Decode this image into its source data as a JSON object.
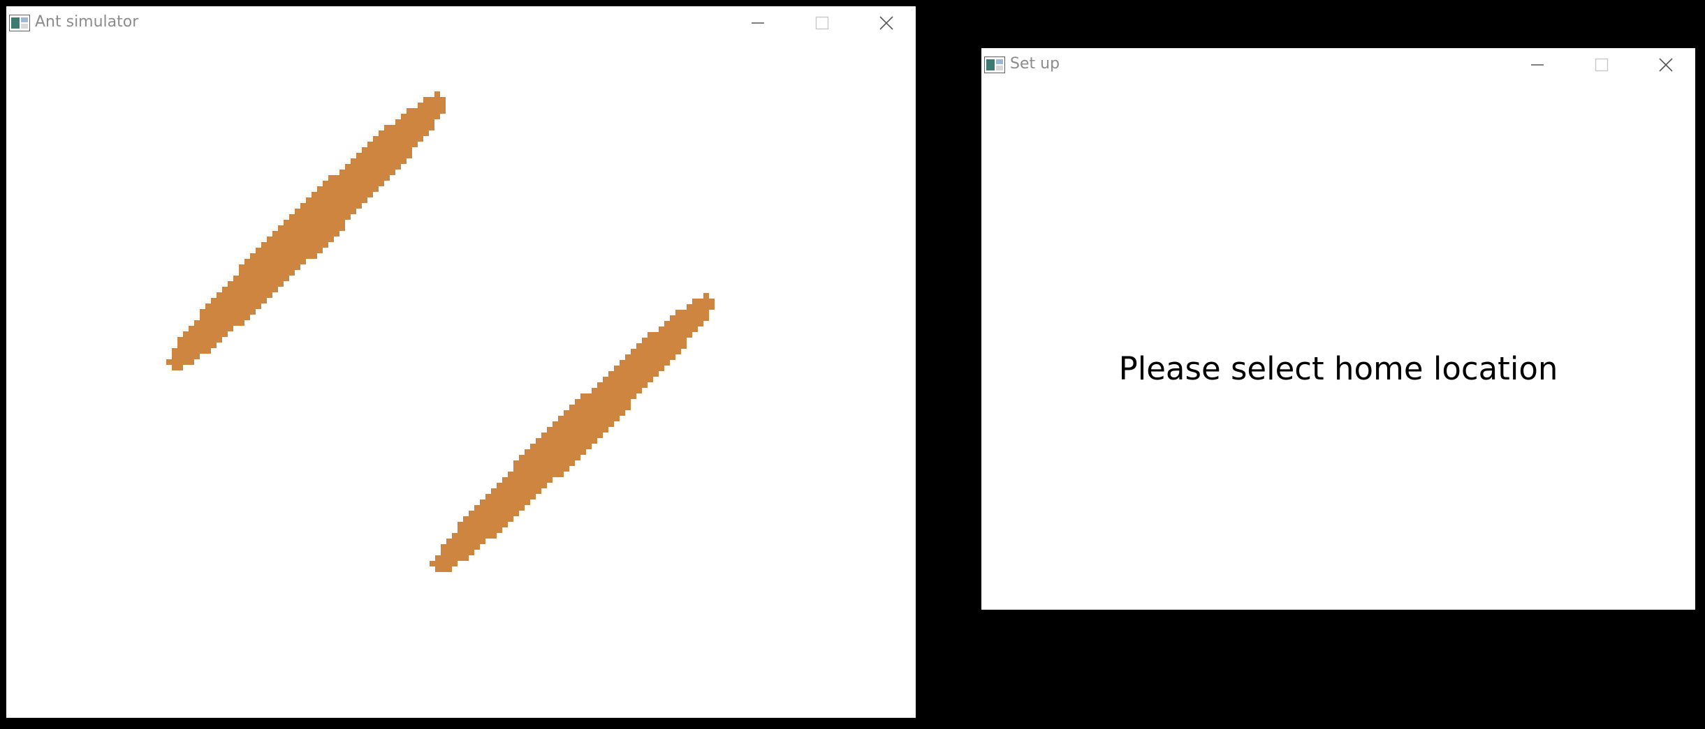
{
  "colors": {
    "desktop": "#000000",
    "window_bg": "#ffffff",
    "title_text": "#8c8c8c",
    "food": "#cd8540"
  },
  "windows": {
    "simulator": {
      "title": "Ant simulator",
      "icon": "app-icon",
      "controls": [
        "minimize-icon",
        "maximize-icon",
        "close-icon"
      ],
      "food_patches": 2
    },
    "setup": {
      "title": "Set up",
      "icon": "app-icon",
      "controls": [
        "minimize-icon",
        "maximize-icon",
        "close-icon"
      ],
      "message": "Please select home location"
    }
  }
}
